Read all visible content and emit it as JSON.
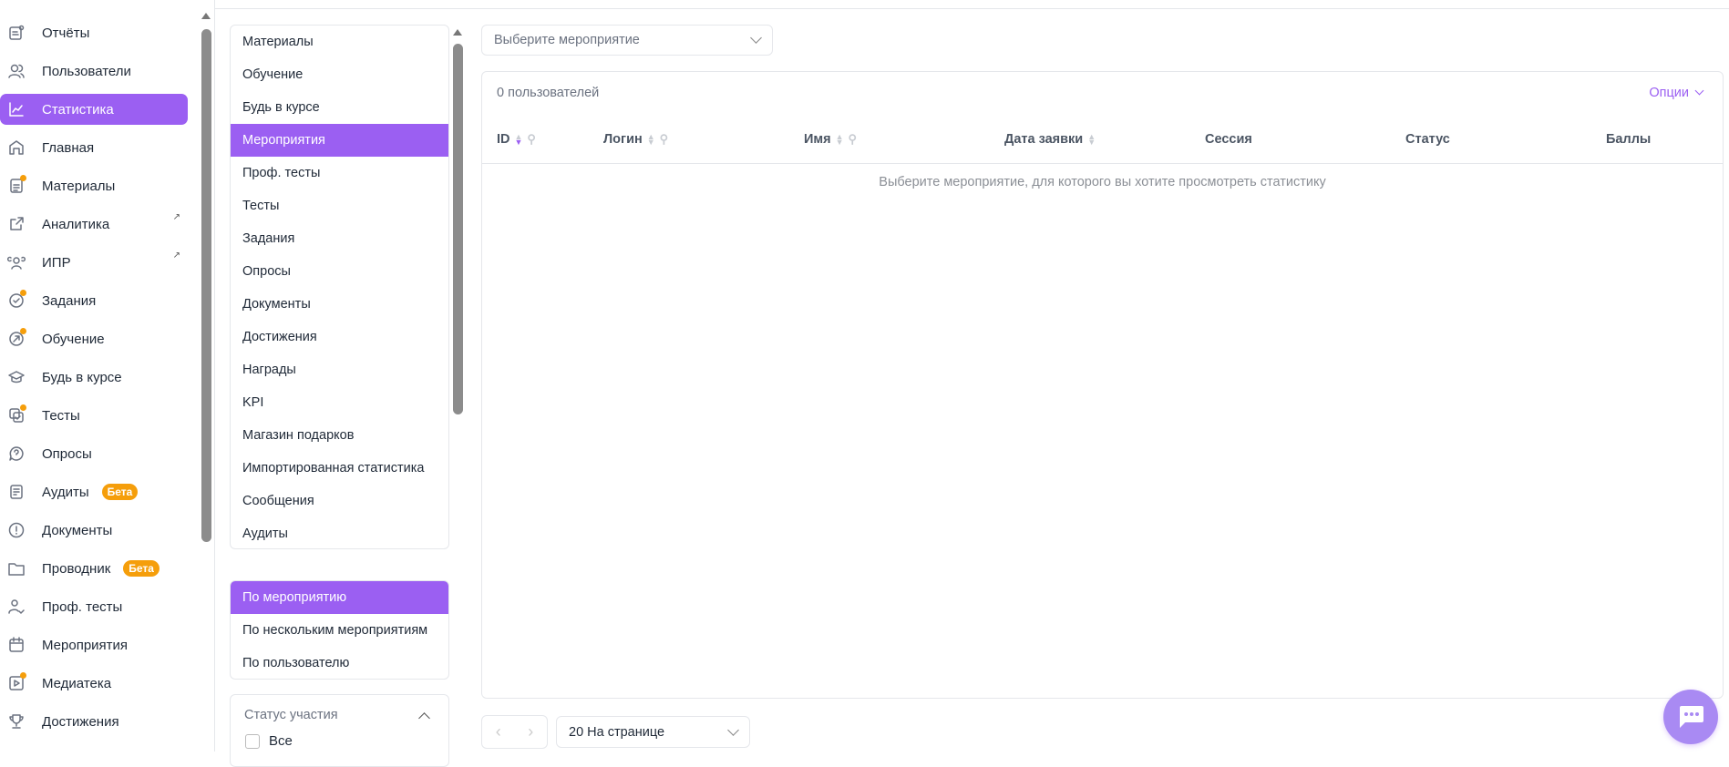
{
  "sidebar": {
    "items": [
      {
        "label": "Отчёты",
        "icon": "reports-icon"
      },
      {
        "label": "Пользователи",
        "icon": "users-icon"
      },
      {
        "label": "Статистика",
        "icon": "chart-icon",
        "active": true
      },
      {
        "label": "Главная",
        "icon": "home-icon"
      },
      {
        "label": "Материалы",
        "icon": "document-icon",
        "dot": true
      },
      {
        "label": "Аналитика",
        "icon": "external-link-icon",
        "external": true
      },
      {
        "label": "ИПР",
        "icon": "team-icon",
        "external": true
      },
      {
        "label": "Задания",
        "icon": "check-circle-icon",
        "dot": true
      },
      {
        "label": "Обучение",
        "icon": "learning-icon",
        "dot": true
      },
      {
        "label": "Будь в курсе",
        "icon": "graduation-cap-icon"
      },
      {
        "label": "Тесты",
        "icon": "test-icon",
        "dot": true
      },
      {
        "label": "Опросы",
        "icon": "question-bubble-icon"
      },
      {
        "label": "Аудиты",
        "icon": "audit-icon",
        "badge": "Бета"
      },
      {
        "label": "Документы",
        "icon": "alert-circle-icon"
      },
      {
        "label": "Проводник",
        "icon": "folder-icon",
        "badge": "Бета"
      },
      {
        "label": "Проф. тесты",
        "icon": "user-check-icon"
      },
      {
        "label": "Мероприятия",
        "icon": "calendar-icon"
      },
      {
        "label": "Медиатека",
        "icon": "media-icon",
        "dot": true
      },
      {
        "label": "Достижения",
        "icon": "trophy-icon"
      }
    ]
  },
  "categories": [
    "Материалы",
    "Обучение",
    "Будь в курсе",
    "Мероприятия",
    "Проф. тесты",
    "Тесты",
    "Задания",
    "Опросы",
    "Документы",
    "Достижения",
    "Награды",
    "KPI",
    "Магазин подарков",
    "Импортированная статистика",
    "Сообщения",
    "Аудиты"
  ],
  "modes": [
    "По мероприятию",
    "По нескольким мероприятиям",
    "По пользователю"
  ],
  "filter": {
    "title": "Статус участия",
    "options": [
      "Все"
    ]
  },
  "event_select": {
    "placeholder": "Выберите мероприятие"
  },
  "table": {
    "count": "0 пользователей",
    "options_label": "Опции",
    "columns": [
      "ID",
      "Логин",
      "Имя",
      "Дата заявки",
      "Сессия",
      "Статус",
      "Баллы"
    ],
    "empty": "Выберите мероприятие, для которого вы хотите просмотреть статистику"
  },
  "pagination": {
    "page_size": "20 На странице"
  },
  "colors": {
    "accent": "#9b5ff2",
    "badge": "#f59e0b"
  }
}
